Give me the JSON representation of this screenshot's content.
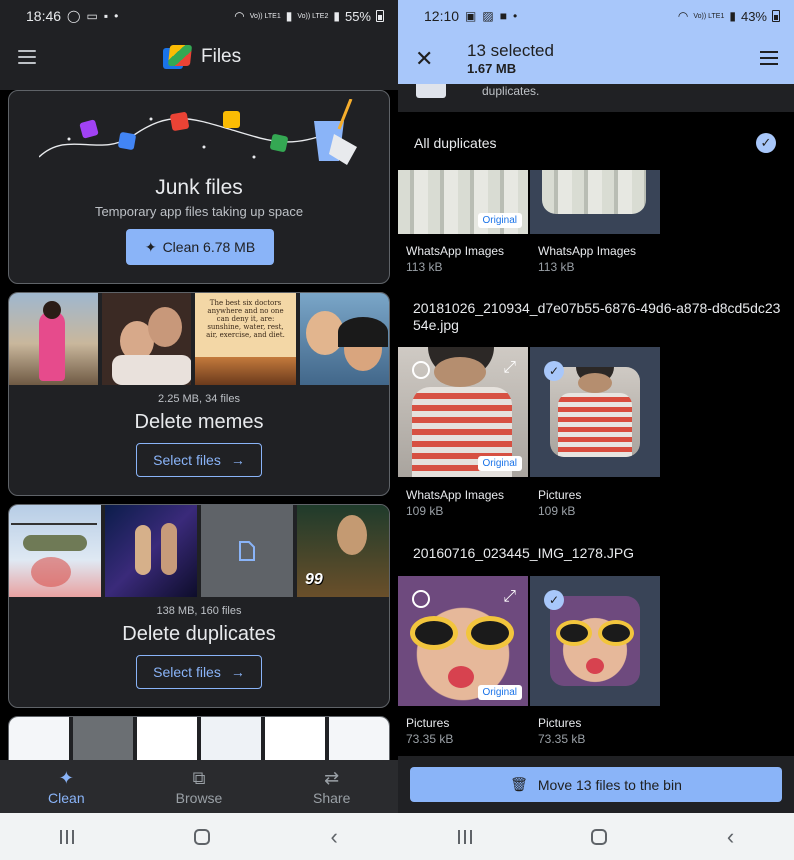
{
  "left": {
    "status": {
      "time": "18:46",
      "battery": "55%",
      "carrier": "Vo)) LTE1",
      "carrier2": "Vo)) LTE2"
    },
    "app_title": "Files",
    "junk": {
      "title": "Junk files",
      "subtitle": "Temporary app files taking up space",
      "button": "Clean 6.78 MB"
    },
    "memes": {
      "count": "2.25 MB, 34 files",
      "title": "Delete memes",
      "button": "Select files",
      "quote_text": "The best six doctors anywhere and no one can deny it, are: sunshine, water, rest, air, exercise, and diet."
    },
    "duplicates": {
      "count": "138 MB, 160 files",
      "title": "Delete duplicates",
      "button": "Select files"
    },
    "nav": {
      "clean": "Clean",
      "browse": "Browse",
      "share": "Share"
    }
  },
  "right": {
    "status": {
      "time": "12:10",
      "battery": "43%",
      "carrier": "Vo)) LTE1"
    },
    "selection_title": "13 selected",
    "selection_size": "1.67 MB",
    "band_text": "duplicates.",
    "all_duplicates": "All duplicates",
    "groups": [
      {
        "name": "",
        "files": [
          {
            "folder": "WhatsApp Images",
            "size": "113 kB",
            "original": true,
            "selected": false
          },
          {
            "folder": "WhatsApp Images",
            "size": "113 kB",
            "original": false,
            "selected": true
          }
        ]
      },
      {
        "name": "20181026_210934_d7e07b55-6876-49d6-a878-d8cd5dc2354e.jpg",
        "files": [
          {
            "folder": "WhatsApp Images",
            "size": "109 kB",
            "original": true,
            "selected": false
          },
          {
            "folder": "Pictures",
            "size": "109 kB",
            "original": false,
            "selected": true
          }
        ]
      },
      {
        "name": "20160716_023445_IMG_1278.JPG",
        "files": [
          {
            "folder": "Pictures",
            "size": "73.35 kB",
            "original": true,
            "selected": false
          },
          {
            "folder": "Pictures",
            "size": "73.35 kB",
            "original": false,
            "selected": true
          }
        ]
      }
    ],
    "original_label": "Original",
    "bin_button": "Move 13 files to the bin"
  },
  "colors": {
    "accent": "#8ab4f8",
    "selection_bar": "#a8c7fa",
    "surface": "#202124"
  }
}
